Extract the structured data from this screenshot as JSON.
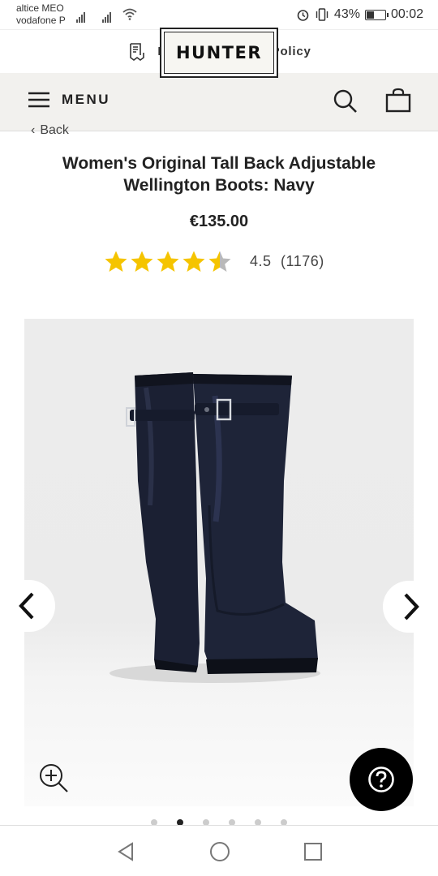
{
  "status_bar": {
    "carrier_1": "altice MEO",
    "carrier_2": "vodafone P",
    "battery_percent": "43%",
    "battery_level": 0.43,
    "time": "00:02"
  },
  "refund_banner": {
    "label": "Extended Refund Policy",
    "icon": "receipt-icon"
  },
  "header": {
    "menu_label": "MENU",
    "logo_text": "HUNTER",
    "background": "#f2f1ee"
  },
  "breadcrumb": {
    "back_label": "Back"
  },
  "product": {
    "title": "Women's Original Tall Back Adjustable Wellington Boots: Navy",
    "price": "€135.00",
    "rating_value": "4.5",
    "review_count": "(1176)",
    "rating_stars": 4.5,
    "star_color": "#f5c400"
  },
  "gallery": {
    "image_alt": "Navy tall boots, back view",
    "slide_count": 6,
    "active_slide": 2
  }
}
